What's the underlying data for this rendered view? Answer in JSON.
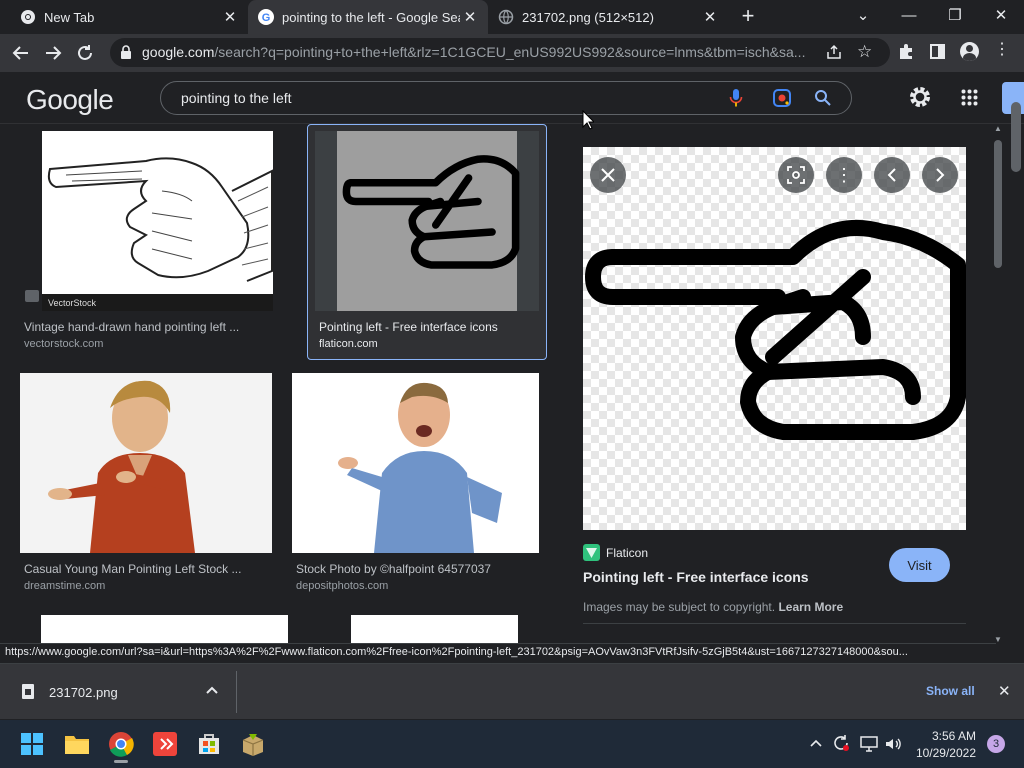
{
  "tabs": [
    {
      "title": "New Tab"
    },
    {
      "title": "pointing to the left - Google Search"
    },
    {
      "title": "231702.png (512×512)"
    }
  ],
  "omnibox": {
    "host": "google.com",
    "path": "/search?q=pointing+to+the+left&rlz=1C1GCEU_enUS992US992&source=lnms&tbm=isch&sa..."
  },
  "google": {
    "logo": "Google",
    "query": "pointing to the left"
  },
  "results": [
    {
      "caption": "Vintage hand-drawn hand pointing left ...",
      "source": "vectorstock.com",
      "watermark": "VectorStock"
    },
    {
      "caption": "Pointing left - Free interface icons",
      "source": "flaticon.com"
    },
    {
      "caption": "Casual Young Man Pointing Left Stock ...",
      "source": "dreamstime.com"
    },
    {
      "caption": "Stock Photo by ©halfpoint 64577037",
      "source": "depositphotos.com"
    }
  ],
  "preview": {
    "site": "Flaticon",
    "title": "Pointing left - Free interface icons",
    "visit_label": "Visit",
    "copyright": "Images may be subject to copyright.",
    "learn_more": "Learn More"
  },
  "statusbar": {
    "url": "https://www.google.com/url?sa=i&url=https%3A%2F%2Fwww.flaticon.com%2Ffree-icon%2Fpointing-left_231702&psig=AOvVaw3n3FVtRfJsifv-5zGjB5t4&ust=1667127327148000&sou..."
  },
  "download": {
    "filename": "231702.png",
    "show_all": "Show all"
  },
  "taskbar": {
    "time": "3:56 AM",
    "date": "10/29/2022",
    "notification_count": "3"
  },
  "colors": {
    "accent": "#8ab4f8",
    "visit_button": "#8ab4f8",
    "flaticon_green": "#2fc27d"
  }
}
